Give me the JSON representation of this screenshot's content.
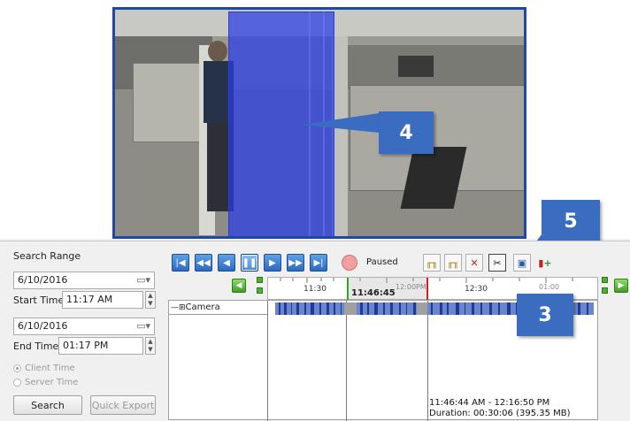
{
  "callouts": {
    "c3": "3",
    "c4": "4",
    "c5": "5"
  },
  "search": {
    "title": "Search Range",
    "start_date": "6/10/2016",
    "start_time_label": "Start Time:",
    "start_time": "11:17 AM",
    "end_date": "6/10/2016",
    "end_time_label": "End Time:",
    "end_time": "01:17 PM",
    "client_time": "Client Time",
    "server_time": "Server Time",
    "search_button": "Search",
    "quick_export_button": "Quick Export"
  },
  "playback": {
    "status": "Paused",
    "icons": [
      "skip-to-start-icon",
      "rewind-icon",
      "step-back-icon",
      "pause-icon",
      "step-forward-icon",
      "fast-forward-icon",
      "skip-to-end-icon",
      "record-icon"
    ]
  },
  "timeline": {
    "camera_label": "Camera",
    "ticks": [
      "11:30",
      "12:00PM",
      "12:30",
      "01:00"
    ],
    "current_time": "11:46:45",
    "selection_range": "11:46:44 AM - 12:16:50 PM",
    "duration": "Duration: 00:30:06 (395.35 MB)"
  },
  "colors": {
    "accent": "#3a6cc0",
    "frame": "#1f47a8",
    "overlay": "#2c3ee0",
    "green_marker": "#2fa52a",
    "red_marker": "#d02020"
  }
}
